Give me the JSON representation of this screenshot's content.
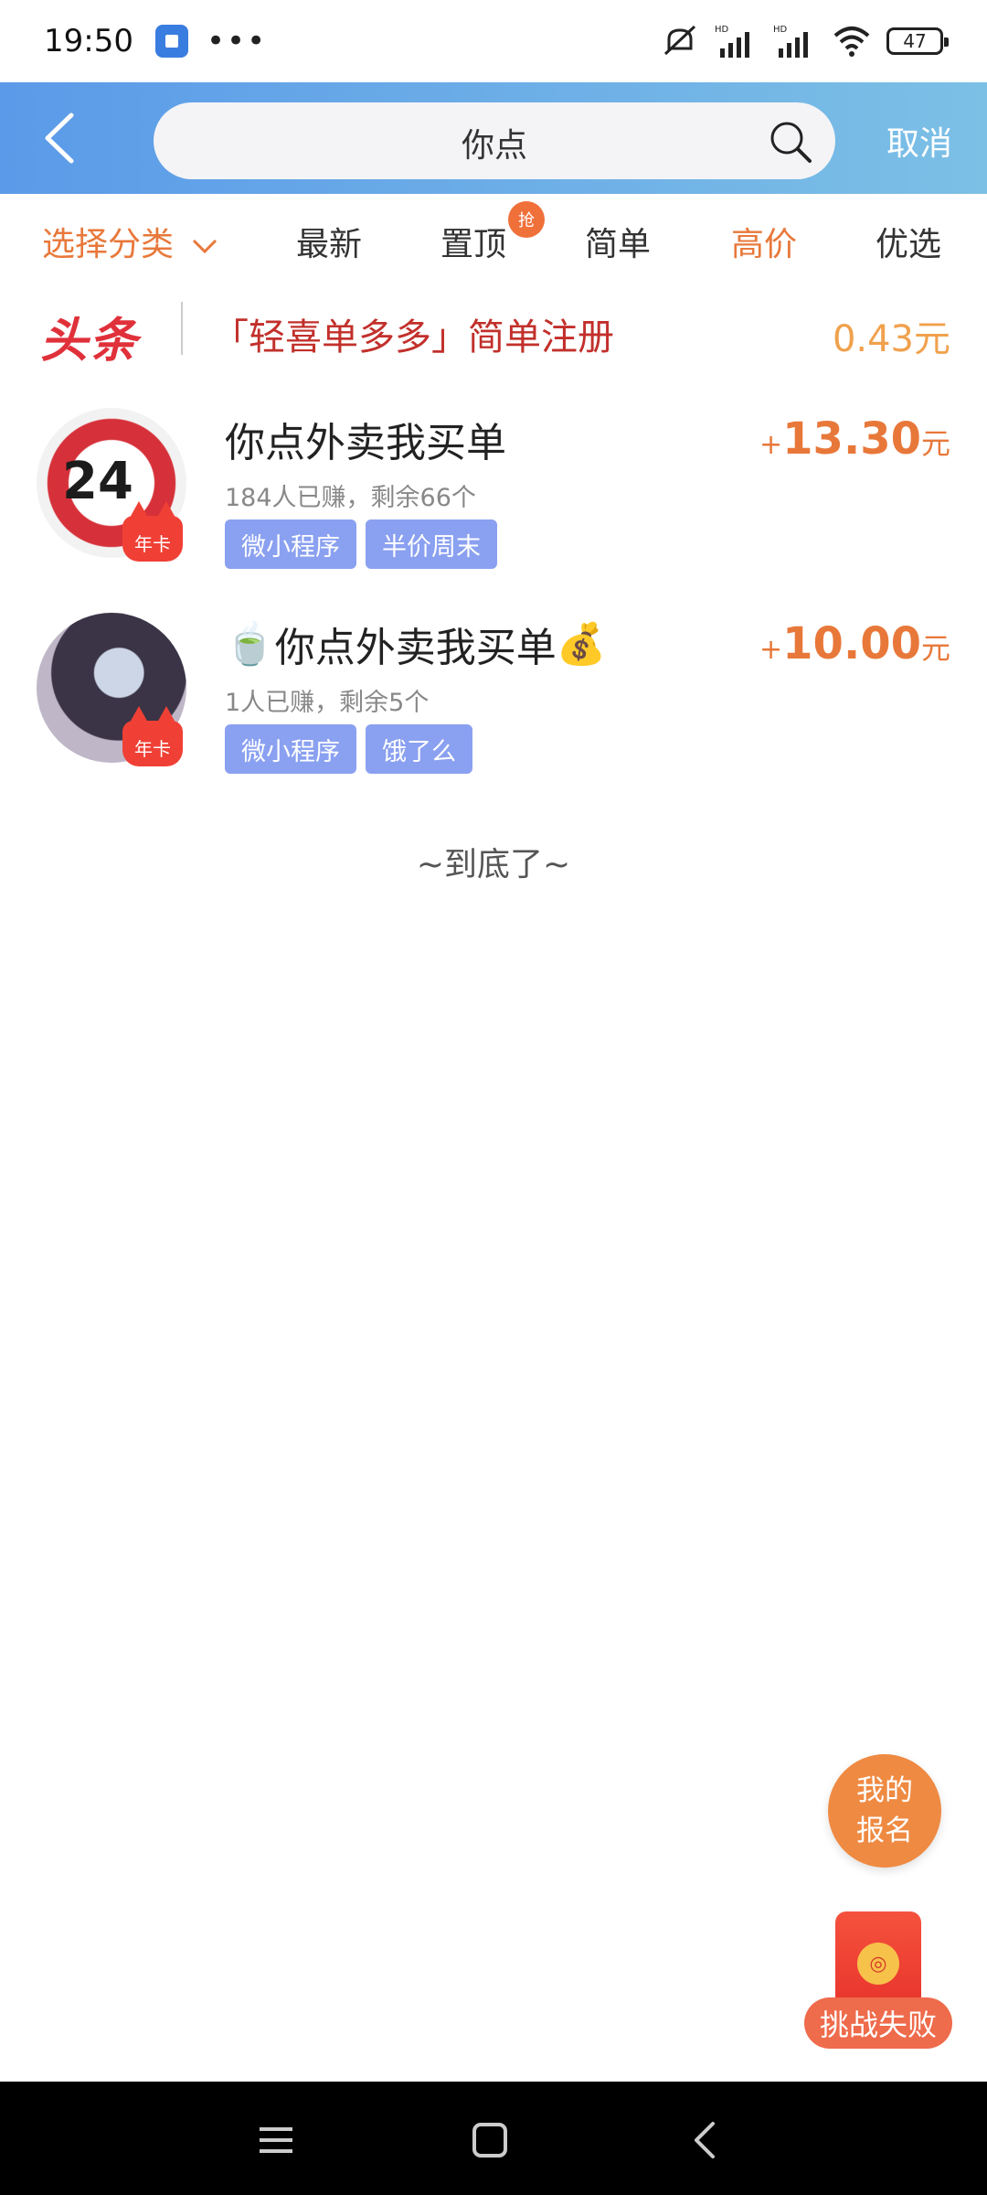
{
  "status_bar": {
    "time": "19:50",
    "battery": "47",
    "icons": [
      "app-notification-icon",
      "more-dots-icon",
      "mute-icon",
      "hd-signal-icon",
      "hd-signal-icon",
      "wifi-icon",
      "battery-icon"
    ]
  },
  "header": {
    "search_value": "你点",
    "cancel_label": "取消",
    "back_icon": "back-arrow-icon",
    "search_icon": "search-icon"
  },
  "tabs": {
    "category_label": "选择分类",
    "items": [
      {
        "label": "最新"
      },
      {
        "label": "置顶",
        "badge": "抢"
      },
      {
        "label": "简单"
      },
      {
        "label": "高价"
      },
      {
        "label": "优选"
      }
    ]
  },
  "headline": {
    "logo": "头条",
    "text": "「轻喜单多多」简单注册",
    "price": "0.43元"
  },
  "tasks": [
    {
      "title": "你点外卖我买单",
      "subtitle": "184人已赚，剩余66个",
      "avatar_text": "24",
      "badge": "年卡",
      "tags": [
        "微小程序",
        "半价周末"
      ],
      "reward_plus": "+",
      "reward_amount": "13.30",
      "reward_unit": "元"
    },
    {
      "title_prefix": "🍵",
      "title": "你点外卖我买单",
      "title_suffix": "💰",
      "subtitle": "1人已赚，剩余5个",
      "badge": "年卡",
      "tags": [
        "微小程序",
        "饿了么"
      ],
      "reward_plus": "+",
      "reward_amount": "10.00",
      "reward_unit": "元"
    }
  ],
  "end_text": "~到底了~",
  "fab": {
    "register_line1": "我的",
    "register_line2": "报名",
    "challenge_label": "挑战失败"
  },
  "colors": {
    "accent_orange": "#e8783a",
    "header_gradient_start": "#5b9ae8",
    "header_gradient_end": "#7cc0e6",
    "tag_blue": "#8aa0f0",
    "headline_red": "#e0313a"
  }
}
